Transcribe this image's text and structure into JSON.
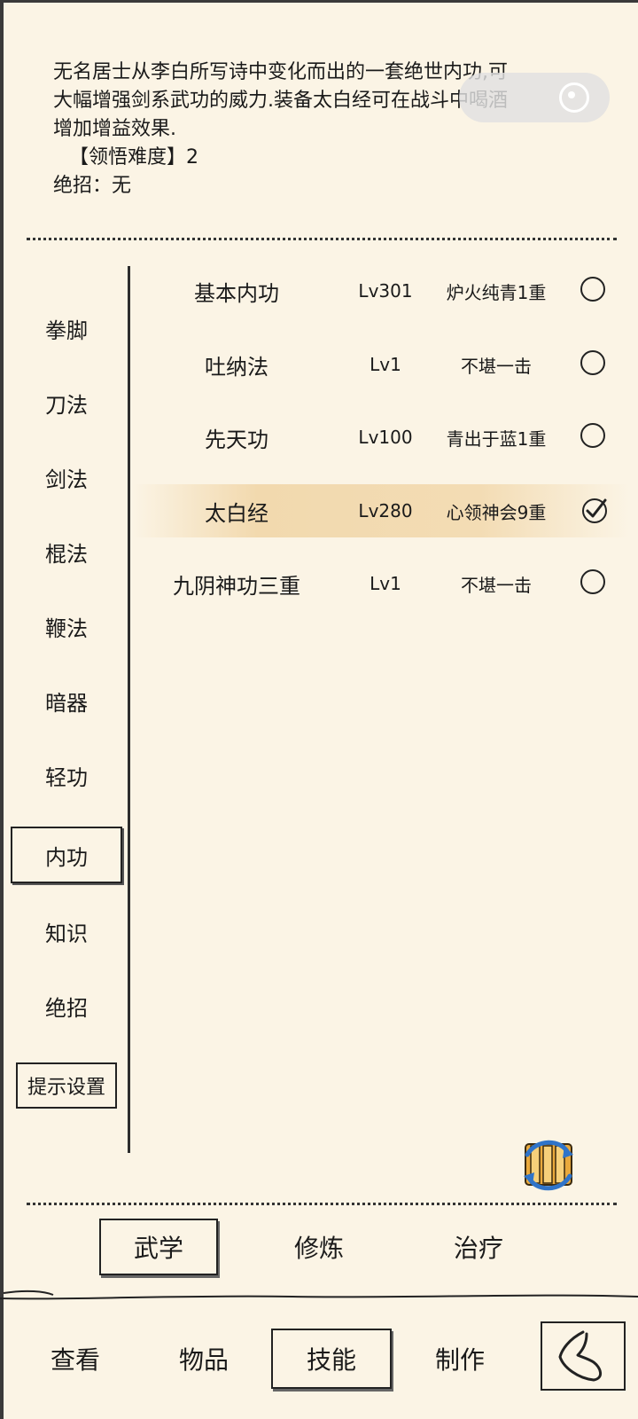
{
  "description": {
    "line1": "无名居士从李白所写诗中变化而出的一套绝世内功,可",
    "line2": "大幅增强剑系武功的威力.装备太白经可在战斗中喝酒",
    "line3": "增加增益效果.",
    "difficulty": "【领悟难度】2",
    "ultimate": "绝招：无"
  },
  "sidebar": {
    "items": [
      {
        "label": "拳脚"
      },
      {
        "label": "刀法"
      },
      {
        "label": "剑法"
      },
      {
        "label": "棍法"
      },
      {
        "label": "鞭法"
      },
      {
        "label": "暗器"
      },
      {
        "label": "轻功"
      },
      {
        "label": "内功"
      },
      {
        "label": "知识"
      },
      {
        "label": "绝招"
      }
    ],
    "active": "内功",
    "hint_settings": "提示设置"
  },
  "skills": [
    {
      "name": "基本内功",
      "level": "Lv301",
      "rank": "炉火纯青1重",
      "equipped": false
    },
    {
      "name": "吐纳法",
      "level": "Lv1",
      "rank": "不堪一击",
      "equipped": false
    },
    {
      "name": "先天功",
      "level": "Lv100",
      "rank": "青出于蓝1重",
      "equipped": false
    },
    {
      "name": "太白经",
      "level": "Lv280",
      "rank": "心领神会9重",
      "equipped": true
    },
    {
      "name": "九阴神功三重",
      "level": "Lv1",
      "rank": "不堪一击",
      "equipped": false
    }
  ],
  "subtabs": {
    "martial": "武学",
    "cultivate": "修炼",
    "heal": "治疗",
    "active": "武学"
  },
  "bottom_nav": {
    "view": "查看",
    "items": "物品",
    "skills": "技能",
    "craft": "制作",
    "active": "技能"
  },
  "icons": {
    "scroll": "scroll-swap-icon",
    "back": "back-icon",
    "capsule": "mini-program-capsule-icon"
  },
  "colors": {
    "background": "#fbf4e5",
    "highlight": "#f2d9ae",
    "ink": "#1a1a1a"
  }
}
